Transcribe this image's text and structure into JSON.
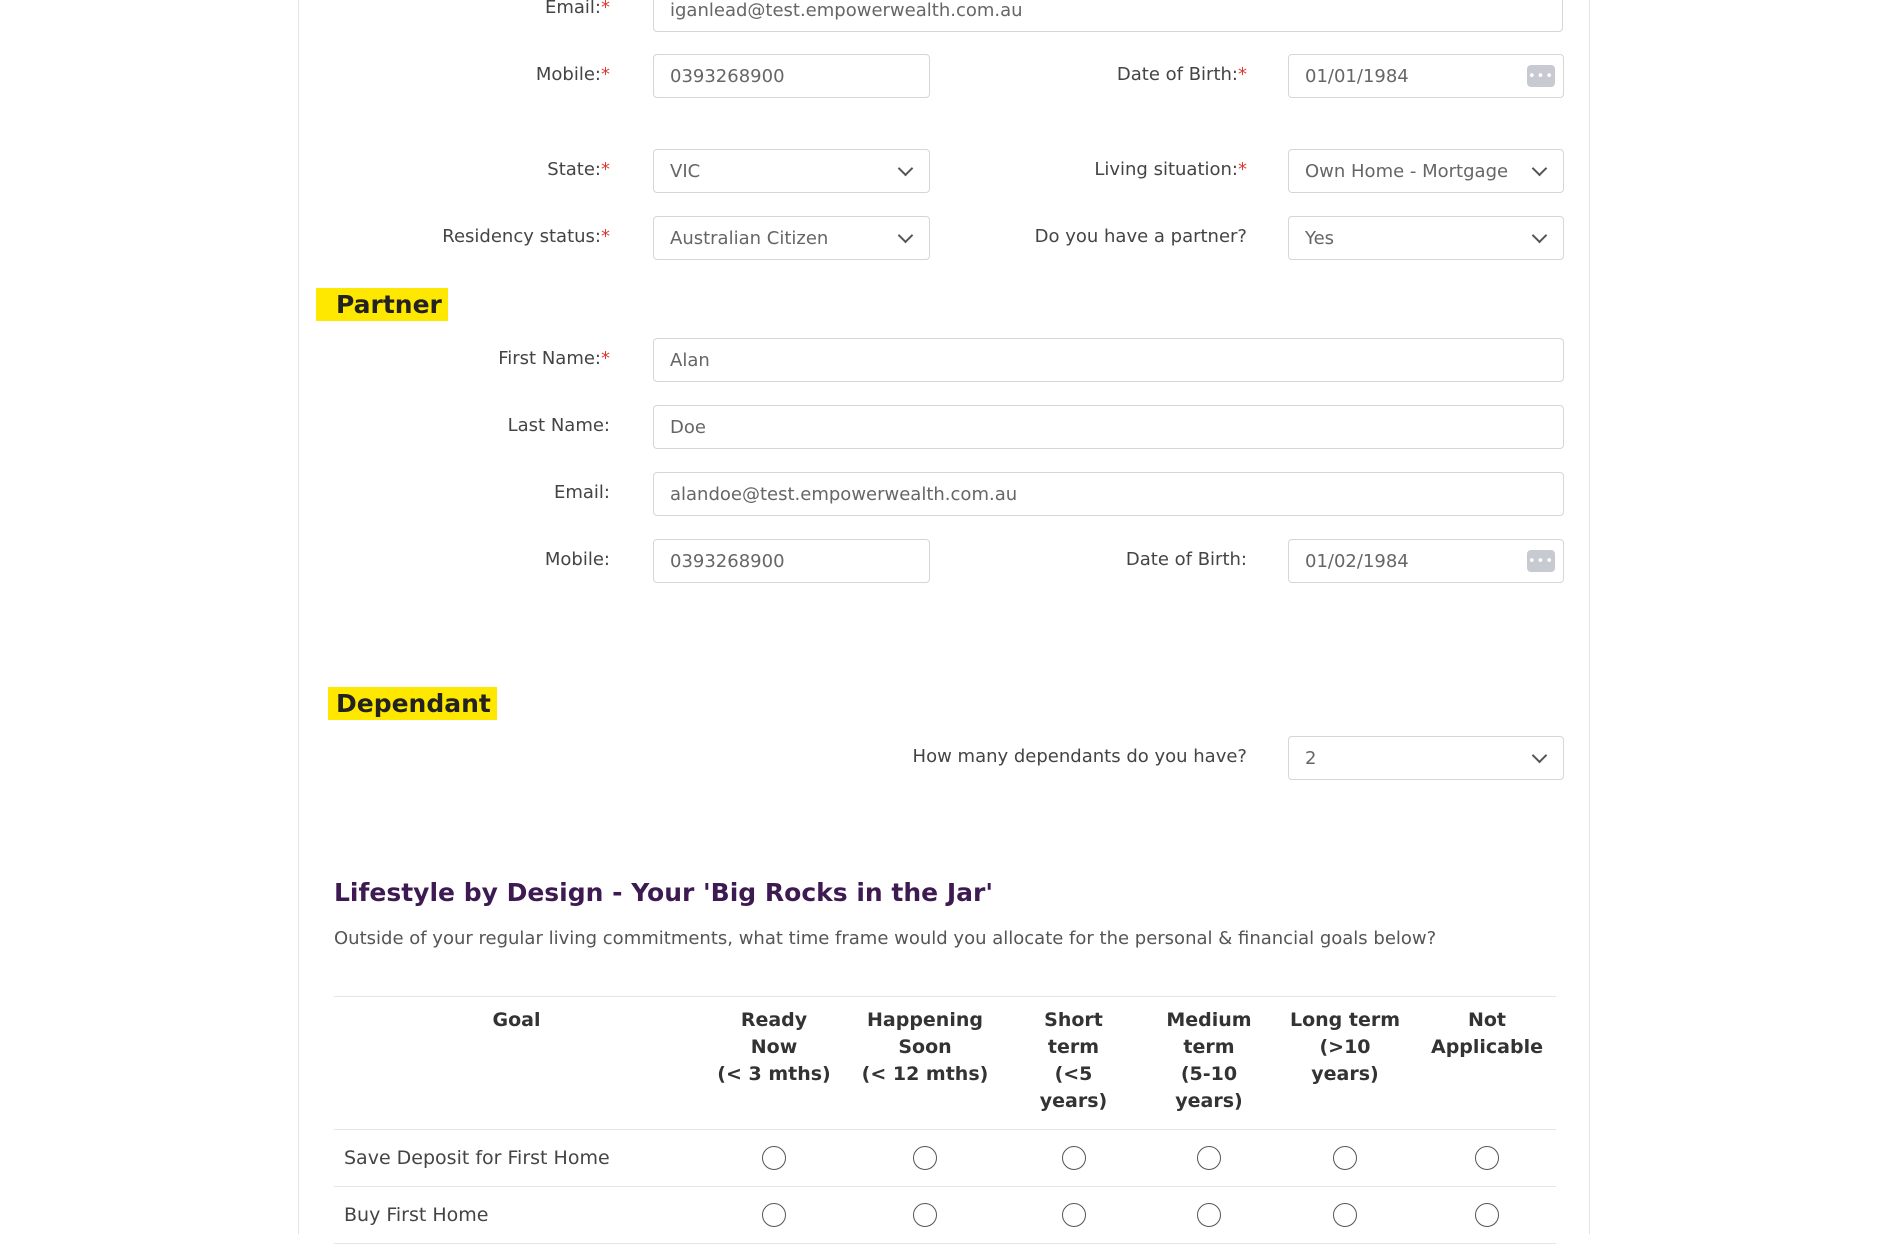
{
  "applicant": {
    "email": {
      "label": "Email:",
      "value": "iganlead@test.empowerwealth.com.au"
    },
    "mobile": {
      "label": "Mobile:",
      "value": "0393268900"
    },
    "dob": {
      "label": "Date of Birth:",
      "value": "01/01/1984"
    },
    "state": {
      "label": "State:",
      "value": "VIC"
    },
    "living": {
      "label": "Living situation:",
      "value": "Own Home - Mortgage"
    },
    "residency": {
      "label": "Residency status:",
      "value": "Australian Citizen"
    },
    "partner_q": {
      "label": "Do you have a partner?",
      "value": "Yes"
    }
  },
  "required_mark": "*",
  "partner": {
    "heading": "Partner",
    "first_name": {
      "label": "First Name:",
      "value": "Alan"
    },
    "last_name": {
      "label": "Last Name:",
      "value": "Doe"
    },
    "email": {
      "label": "Email:",
      "value": "alandoe@test.empowerwealth.com.au"
    },
    "mobile": {
      "label": "Mobile:",
      "value": "0393268900"
    },
    "dob": {
      "label": "Date of Birth:",
      "value": "01/02/1984"
    }
  },
  "dependant": {
    "heading": "Dependant",
    "count": {
      "label": "How many dependants do you have?",
      "value": "2"
    }
  },
  "lifestyle": {
    "title": "Lifestyle by Design - Your 'Big Rocks in the Jar'",
    "subtitle": "Outside of your regular living commitments, what time frame would you allocate for the personal & financial goals below?",
    "columns": {
      "goal": "Goal",
      "c1": [
        "Ready",
        "Now",
        "(< 3 mths)"
      ],
      "c2": [
        "Happening",
        "Soon",
        "(< 12 mths)"
      ],
      "c3": [
        "Short",
        "term",
        "(<5",
        "years)"
      ],
      "c4": [
        "Medium",
        "term",
        "(5-10 years)"
      ],
      "c5": [
        "Long term",
        "(>10",
        "years)"
      ],
      "c6": [
        "Not",
        "Applicable"
      ]
    },
    "rows": [
      "Save Deposit for First Home",
      "Buy First Home"
    ]
  },
  "icons": {
    "select": "chevron-down-icon",
    "date": "calendar-icon"
  },
  "colors": {
    "highlight": "#ffe800",
    "title": "#3d1a52",
    "required": "#e0392f"
  }
}
